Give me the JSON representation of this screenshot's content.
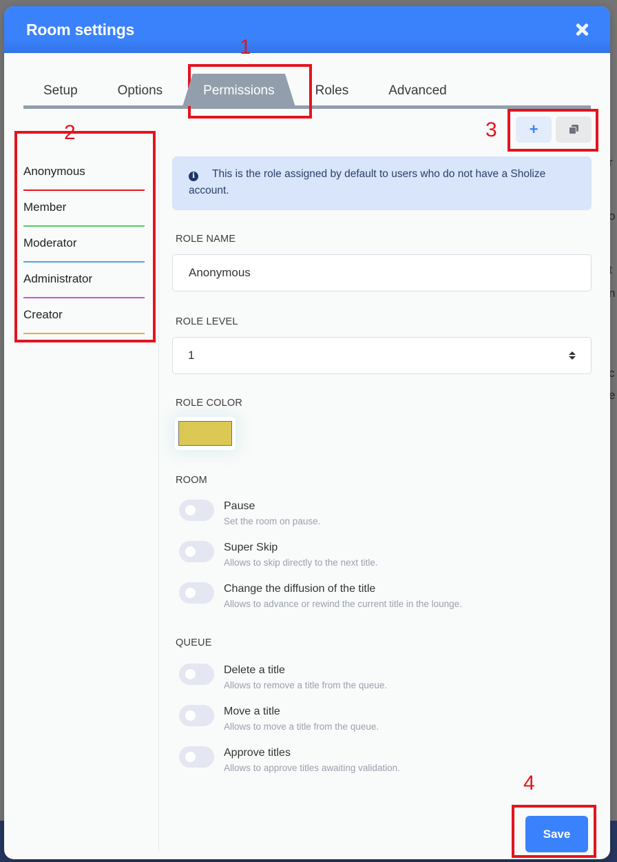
{
  "background": {
    "right_text_fragments": [
      "r",
      "o",
      "t",
      "n",
      "c",
      "e"
    ]
  },
  "dialog": {
    "title": "Room settings",
    "close_icon": "close-x-icon"
  },
  "tabs": [
    {
      "label": "Setup",
      "active": false
    },
    {
      "label": "Options",
      "active": false
    },
    {
      "label": "Permissions",
      "active": true
    },
    {
      "label": "Roles",
      "active": false
    },
    {
      "label": "Advanced",
      "active": false
    }
  ],
  "toolbar": {
    "add_label": "+",
    "add_icon": "plus-icon",
    "duplicate_icon": "duplicate-icon"
  },
  "roles": [
    {
      "name": "Anonymous",
      "color": "#e8141e",
      "selected": true
    },
    {
      "name": "Member",
      "color": "#4ccf63"
    },
    {
      "name": "Moderator",
      "color": "#44a9dd"
    },
    {
      "name": "Administrator",
      "color": "#d64fd6"
    },
    {
      "name": "Creator",
      "color": "#e0b041"
    }
  ],
  "info": {
    "icon": "info-circle-icon",
    "text": "This is the role assigned by default to users who do not have a Sholize account."
  },
  "form": {
    "role_name_label": "ROLE NAME",
    "role_name_value": "Anonymous",
    "role_level_label": "ROLE LEVEL",
    "role_level_value": "1",
    "role_color_label": "ROLE COLOR",
    "role_color_value": "#dcc955"
  },
  "sections": [
    {
      "title": "ROOM",
      "permissions": [
        {
          "title": "Pause",
          "description": "Set the room on pause.",
          "enabled": false
        },
        {
          "title": "Super Skip",
          "description": "Allows to skip directly to the next title.",
          "enabled": false
        },
        {
          "title": "Change the diffusion of the title",
          "description": "Allows to advance or rewind the current title in the lounge.",
          "enabled": false
        }
      ]
    },
    {
      "title": "QUEUE",
      "permissions": [
        {
          "title": "Delete a title",
          "description": "Allows to remove a title from the queue.",
          "enabled": false
        },
        {
          "title": "Move a title",
          "description": "Allows to move a title from the queue.",
          "enabled": false
        },
        {
          "title": "Approve titles",
          "description": "Allows to approve titles awaiting validation.",
          "enabled": false
        }
      ]
    }
  ],
  "footer": {
    "save_label": "Save"
  },
  "annotations": {
    "color": "#e3141e",
    "labels": [
      "1",
      "2",
      "3",
      "4"
    ]
  }
}
